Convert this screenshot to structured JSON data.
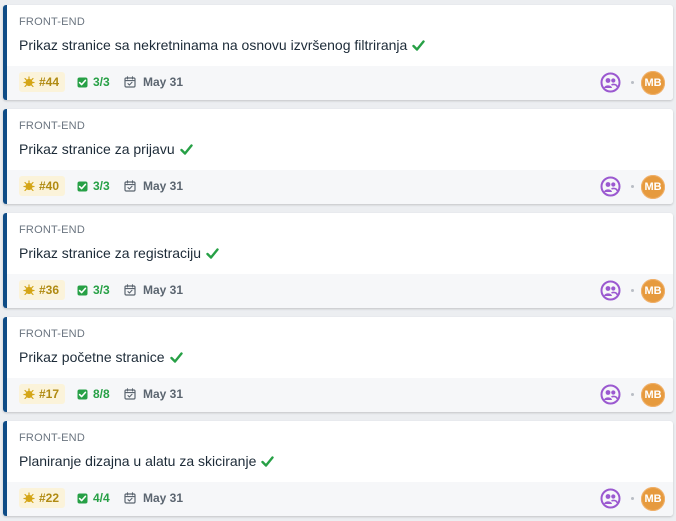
{
  "cards": [
    {
      "category": "FRONT-END",
      "title": "Prikaz stranice sa nekretninama na osnovu izvršenog filtriranja",
      "issue_id": "#44",
      "checklist": "3/3",
      "due_date": "May 31",
      "assignee_initials": "MB"
    },
    {
      "category": "FRONT-END",
      "title": "Prikaz stranice za prijavu",
      "issue_id": "#40",
      "checklist": "3/3",
      "due_date": "May 31",
      "assignee_initials": "MB"
    },
    {
      "category": "FRONT-END",
      "title": "Prikaz stranice za registraciju",
      "issue_id": "#36",
      "checklist": "3/3",
      "due_date": "May 31",
      "assignee_initials": "MB"
    },
    {
      "category": "FRONT-END",
      "title": "Prikaz početne stranice",
      "issue_id": "#17",
      "checklist": "8/8",
      "due_date": "May 31",
      "assignee_initials": "MB"
    },
    {
      "category": "FRONT-END",
      "title": "Planiranje dizajna u alatu za skiciranje",
      "issue_id": "#22",
      "checklist": "4/4",
      "due_date": "May 31",
      "assignee_initials": "MB"
    }
  ],
  "icons": {
    "issue": "bug-icon",
    "title_status": "checkmark-icon",
    "checklist": "checkbox-checked-icon",
    "due_date": "calendar-icon",
    "team": "people-icon"
  },
  "colors": {
    "card_accent": "#0f4c86",
    "issue_badge_bg": "#fbf3da",
    "issue_badge_text": "#b08a11",
    "checklist_green": "#27a046",
    "team_purple": "#9b59d0",
    "avatar_orange": "#e69a3e"
  }
}
